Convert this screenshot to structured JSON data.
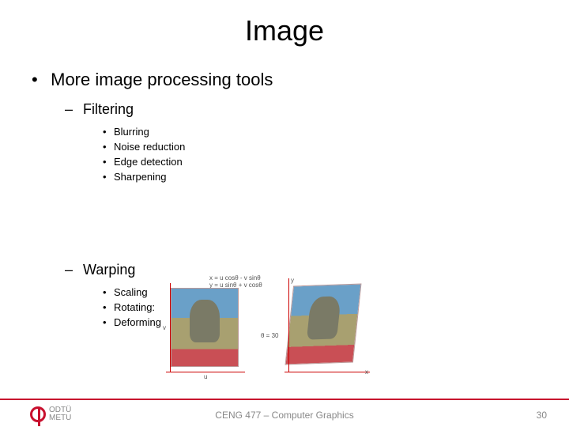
{
  "title": "Image",
  "main_bullet": "More image processing tools",
  "sections": {
    "filtering": {
      "label": "Filtering",
      "items": [
        "Blurring",
        "Noise reduction",
        "Edge detection",
        "Sharpening"
      ]
    },
    "warping": {
      "label": "Warping",
      "items": [
        "Scaling",
        "Rotating:",
        "Deforming"
      ]
    }
  },
  "figure": {
    "eq1": "x = u cosθ - v sinθ",
    "eq2": "y = u sinθ + v cosθ",
    "theta": "θ = 30",
    "axis_u": "u",
    "axis_v": "v",
    "axis_x": "x",
    "axis_y": "y"
  },
  "footer": {
    "logo_line1": "ODTÜ",
    "logo_line2": "METU",
    "center": "CENG 477 – Computer Graphics",
    "page": "30"
  }
}
